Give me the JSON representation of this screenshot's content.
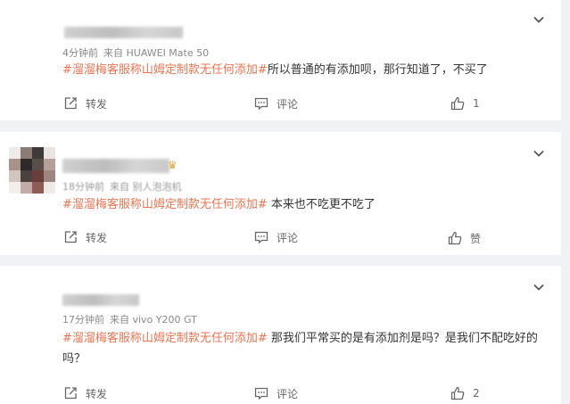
{
  "comments": [
    {
      "time": "4分钟前",
      "source": "来自 HUAWEI Mate 50",
      "hashtag": "#溜溜梅客服称山姆定制款无任何添加#",
      "text": "所以普通的有添加呗，那行知道了，不买了",
      "forward_label": "转发",
      "comment_label": "评论",
      "like_label": "1"
    },
    {
      "time": "18分钟前",
      "source": "来自 别人泡泡机",
      "hashtag": "#溜溜梅客服称山姆定制款无任何添加#",
      "text": " 本来也不吃更不吃了",
      "forward_label": "转发",
      "comment_label": "评论",
      "like_label": "赞"
    },
    {
      "time": "17分钟前",
      "source": "来自 vivo Y200 GT",
      "hashtag": "#溜溜梅客服称山姆定制款无任何添加#",
      "text": " 那我们平常买的是有添加剂是吗？是我们不配吃好的吗？",
      "forward_label": "转发",
      "comment_label": "评论",
      "like_label": "2"
    }
  ],
  "colors": {
    "hashtag": "#eb7350",
    "background": "#f1f2f5"
  },
  "icons": {
    "forward": "forward-icon",
    "comment": "comment-icon",
    "like": "thumbs-up-icon",
    "menu": "chevron-down-icon"
  }
}
